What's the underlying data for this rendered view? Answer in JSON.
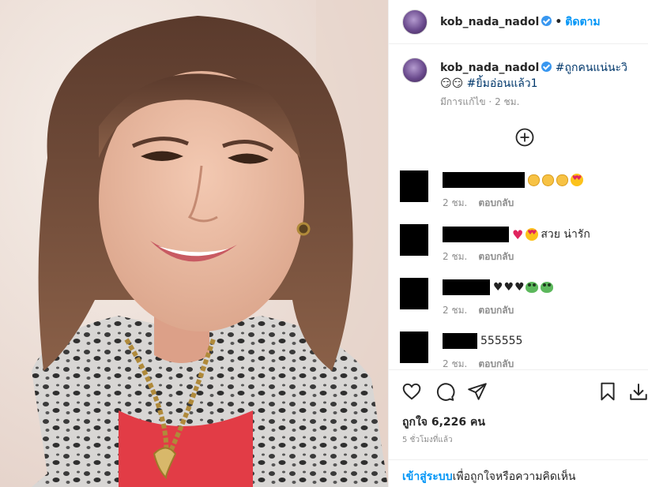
{
  "header": {
    "username": "kob_nada_nadol",
    "separator": "•",
    "follow_label": "ติดตาม"
  },
  "caption": {
    "username": "kob_nada_nadol",
    "hashtag1": "#ถูกคนแน่นะวิ",
    "emojis": "😏😏",
    "hashtag2": "#ยิ้มอ่อนแล้ว1",
    "edited": "มีการแก้ไข",
    "time": "2 ชม."
  },
  "comments": [
    {
      "text": "",
      "time": "2 ชม.",
      "reply": "ตอบกลับ"
    },
    {
      "text": "สวย น่ารัก",
      "time": "2 ชม.",
      "reply": "ตอบกลับ"
    },
    {
      "text": "",
      "time": "2 ชม.",
      "reply": "ตอบกลับ"
    },
    {
      "text": "555555",
      "time": "2 ชม.",
      "reply": "ตอบกลับ"
    }
  ],
  "likes": "ถูกใจ 6,226 คน",
  "posted": "5 ชั่วโมงที่แล้ว",
  "footer": {
    "login": "เข้าสู่ระบบ",
    "rest": "เพื่อถูกใจหรือความคิดเห็น"
  },
  "icons": {
    "verified": "verified-badge-icon",
    "load_more": "plus-circle-icon",
    "like": "heart-icon",
    "comment": "comment-icon",
    "share": "share-icon",
    "save": "bookmark-icon",
    "download": "download-icon"
  },
  "colors": {
    "accent": "#0095f6",
    "hashtag": "#00376b",
    "secondary": "#8e8e8e",
    "verified": "#3897f0"
  }
}
